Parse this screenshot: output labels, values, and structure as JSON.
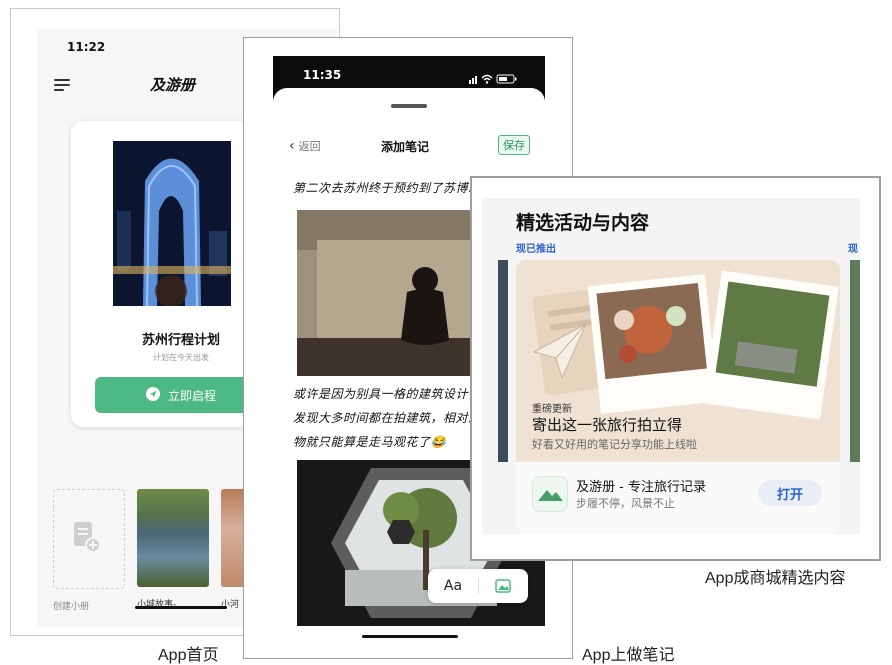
{
  "home": {
    "time": "11:22",
    "app_title": "及游册",
    "plan_title": "苏州行程计划",
    "plan_subtitle": "计划在今天出发",
    "start_button": "立即启程",
    "create_label": "创建小册",
    "thumbs": [
      {
        "label": "小城故事-"
      },
      {
        "label": "小河"
      }
    ],
    "caption": "App首页"
  },
  "note": {
    "time": "11:35",
    "back_label": "返回",
    "title": "添加笔记",
    "save_label": "保存",
    "line1": "第二次去苏州终于预约到了苏博!",
    "para_lines": [
      "或许是因为别具一格的建筑设计，",
      "发现大多时间都在拍建筑，相对之",
      "物就只能算是走马观花了😂"
    ],
    "aa_label": "Aa",
    "caption": "App上做笔记"
  },
  "store": {
    "heading": "精选活动与内容",
    "tag": "现已推出",
    "tag_right": "现",
    "card_kicker": "重磅更新",
    "card_title": "寄出这一张旅行拍立得",
    "card_subtitle": "好看又好用的笔记分享功能上线啦",
    "app_name": "及游册 - 专注旅行记录",
    "app_slogan": "步履不停，风景不止",
    "open_button": "打开",
    "caption": "App成商城精选内容"
  },
  "colors": {
    "accent_green": "#4cb883",
    "store_blue": "#2a64c8"
  },
  "icons": [
    "menu-icon",
    "send-icon",
    "add-note-icon",
    "back-chevron-icon",
    "image-icon",
    "mountain-icon",
    "paper-plane-icon",
    "signal-icon",
    "wifi-icon",
    "battery-icon"
  ]
}
